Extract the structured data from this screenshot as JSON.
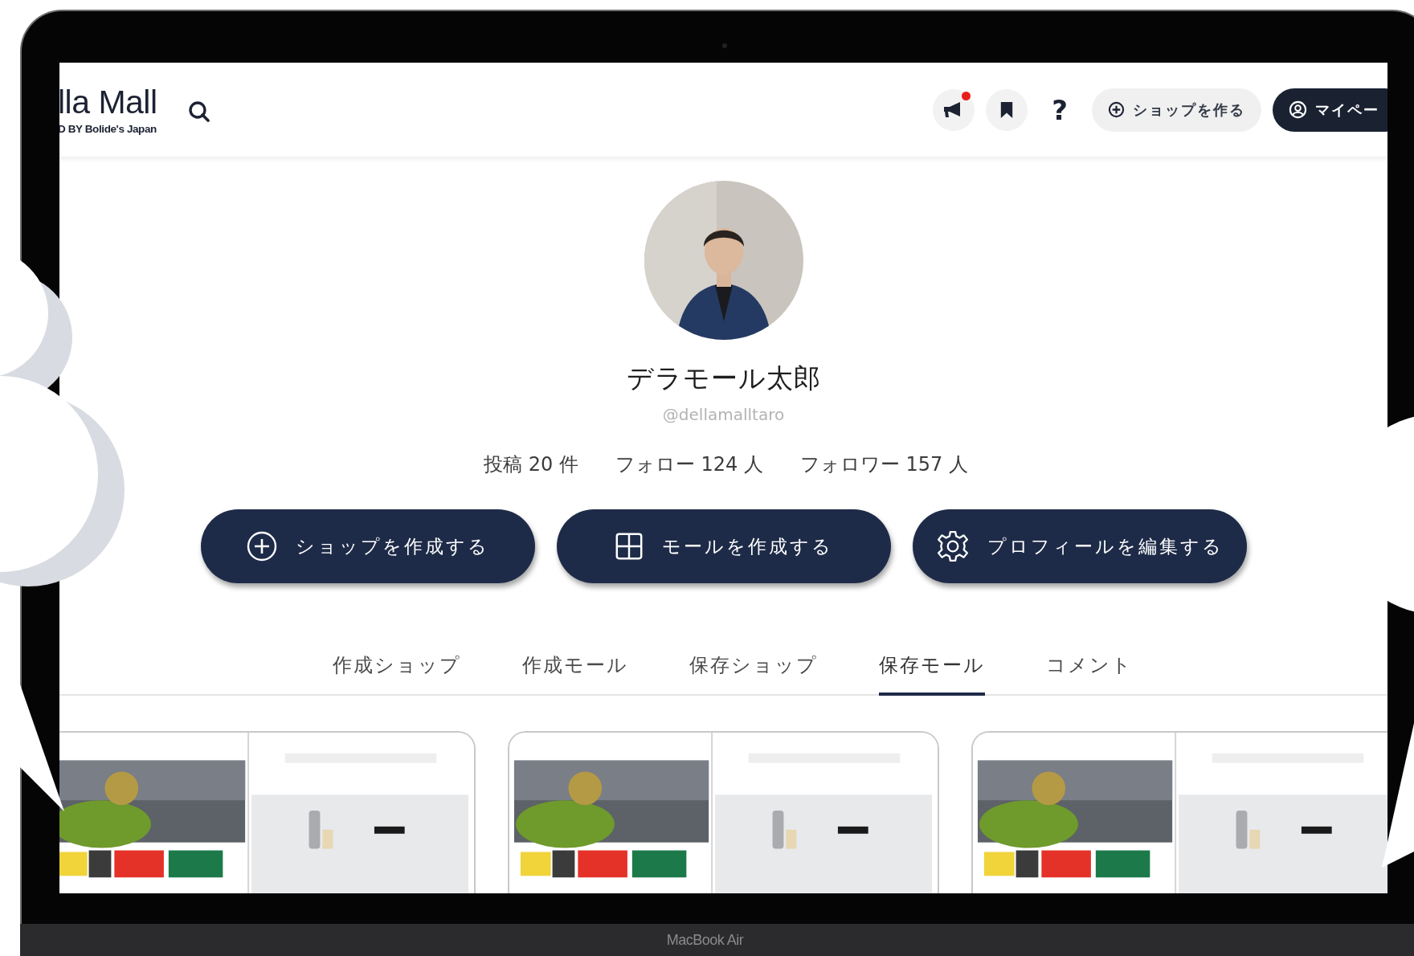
{
  "device_label": "MacBook Air",
  "header": {
    "logo": {
      "title": "lla Mall",
      "subtitle": "D BY Bolide's Japan"
    },
    "icon_buttons": [
      {
        "kind": "announcements",
        "badge": true
      },
      {
        "kind": "saved",
        "badge": false
      },
      {
        "kind": "help",
        "label": "?",
        "badge": false
      }
    ],
    "create_shop_button": {
      "label": "ショップを作る"
    },
    "mypage_button": {
      "label": "マイペー"
    }
  },
  "profile": {
    "name": "デラモール太郎",
    "handle": "@dellamalltaro",
    "stats": [
      "投稿 20 件",
      "フォロー 124 人",
      "フォロワー 157 人"
    ],
    "actions": [
      {
        "kind": "shop",
        "label": "ショップを作成する"
      },
      {
        "kind": "mall",
        "label": "モールを作成する"
      },
      {
        "kind": "edit",
        "label": "プロフィールを編集する"
      }
    ]
  },
  "tabs": [
    {
      "label": "作成ショップ",
      "selected": false
    },
    {
      "label": "作成モール",
      "selected": false
    },
    {
      "label": "保存ショップ",
      "selected": false
    },
    {
      "label": "保存モール",
      "selected": true
    },
    {
      "label": "コメント",
      "selected": false
    }
  ]
}
